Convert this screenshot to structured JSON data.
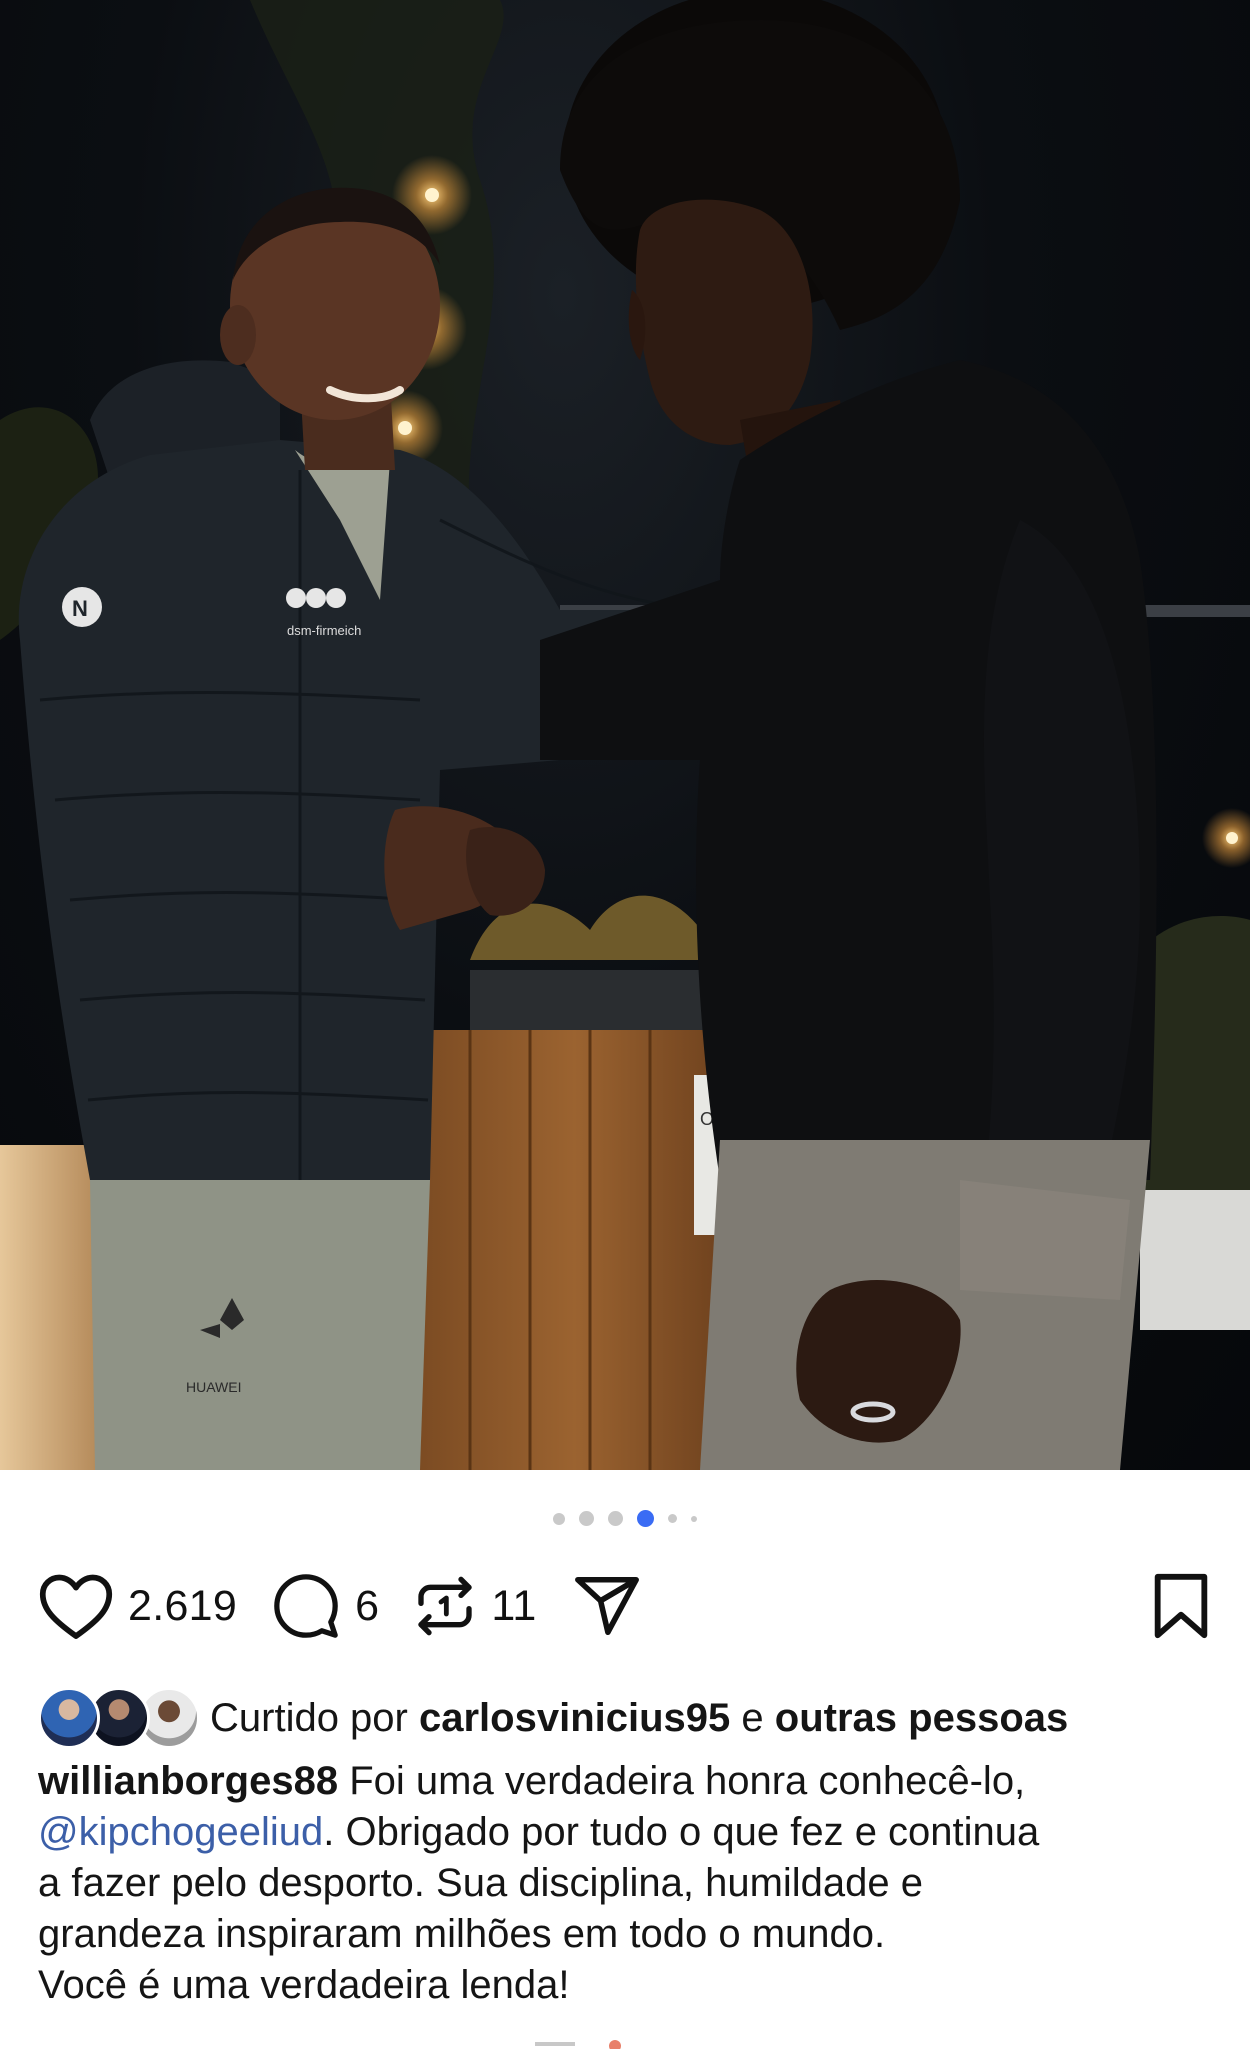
{
  "photo": {
    "jacket_brand": "dsm-firmeich",
    "pants_brand": "HUAWEI",
    "sign_text": "ORG"
  },
  "carousel": {
    "count": 6,
    "active_index": 3
  },
  "actions": {
    "like_count": "2.619",
    "comment_count": "6",
    "repost_count": "11"
  },
  "liked_by": {
    "prefix": "Curtido por",
    "user": "carlosvinicius95",
    "connector": "e",
    "others": "outras pessoas"
  },
  "caption": {
    "author": "willianborges88",
    "line1": "Foi uma verdadeira honra conhecê-lo,",
    "mention": "@kipchogeeliud",
    "line2_rest": ". Obrigado por tudo o que fez e continua",
    "line3": "a fazer pelo desporto. Sua disciplina, humildade e",
    "line4": "grandeza inspiraram milhões em todo o mundo.",
    "line5": "Você é uma verdadeira lenda!"
  },
  "colors": {
    "accent_dot": "#3a6cf4",
    "mention": "#3c5fa8",
    "text": "#151515"
  },
  "icons": [
    "heart-icon",
    "comment-icon",
    "repost-icon",
    "share-icon",
    "bookmark-icon"
  ]
}
